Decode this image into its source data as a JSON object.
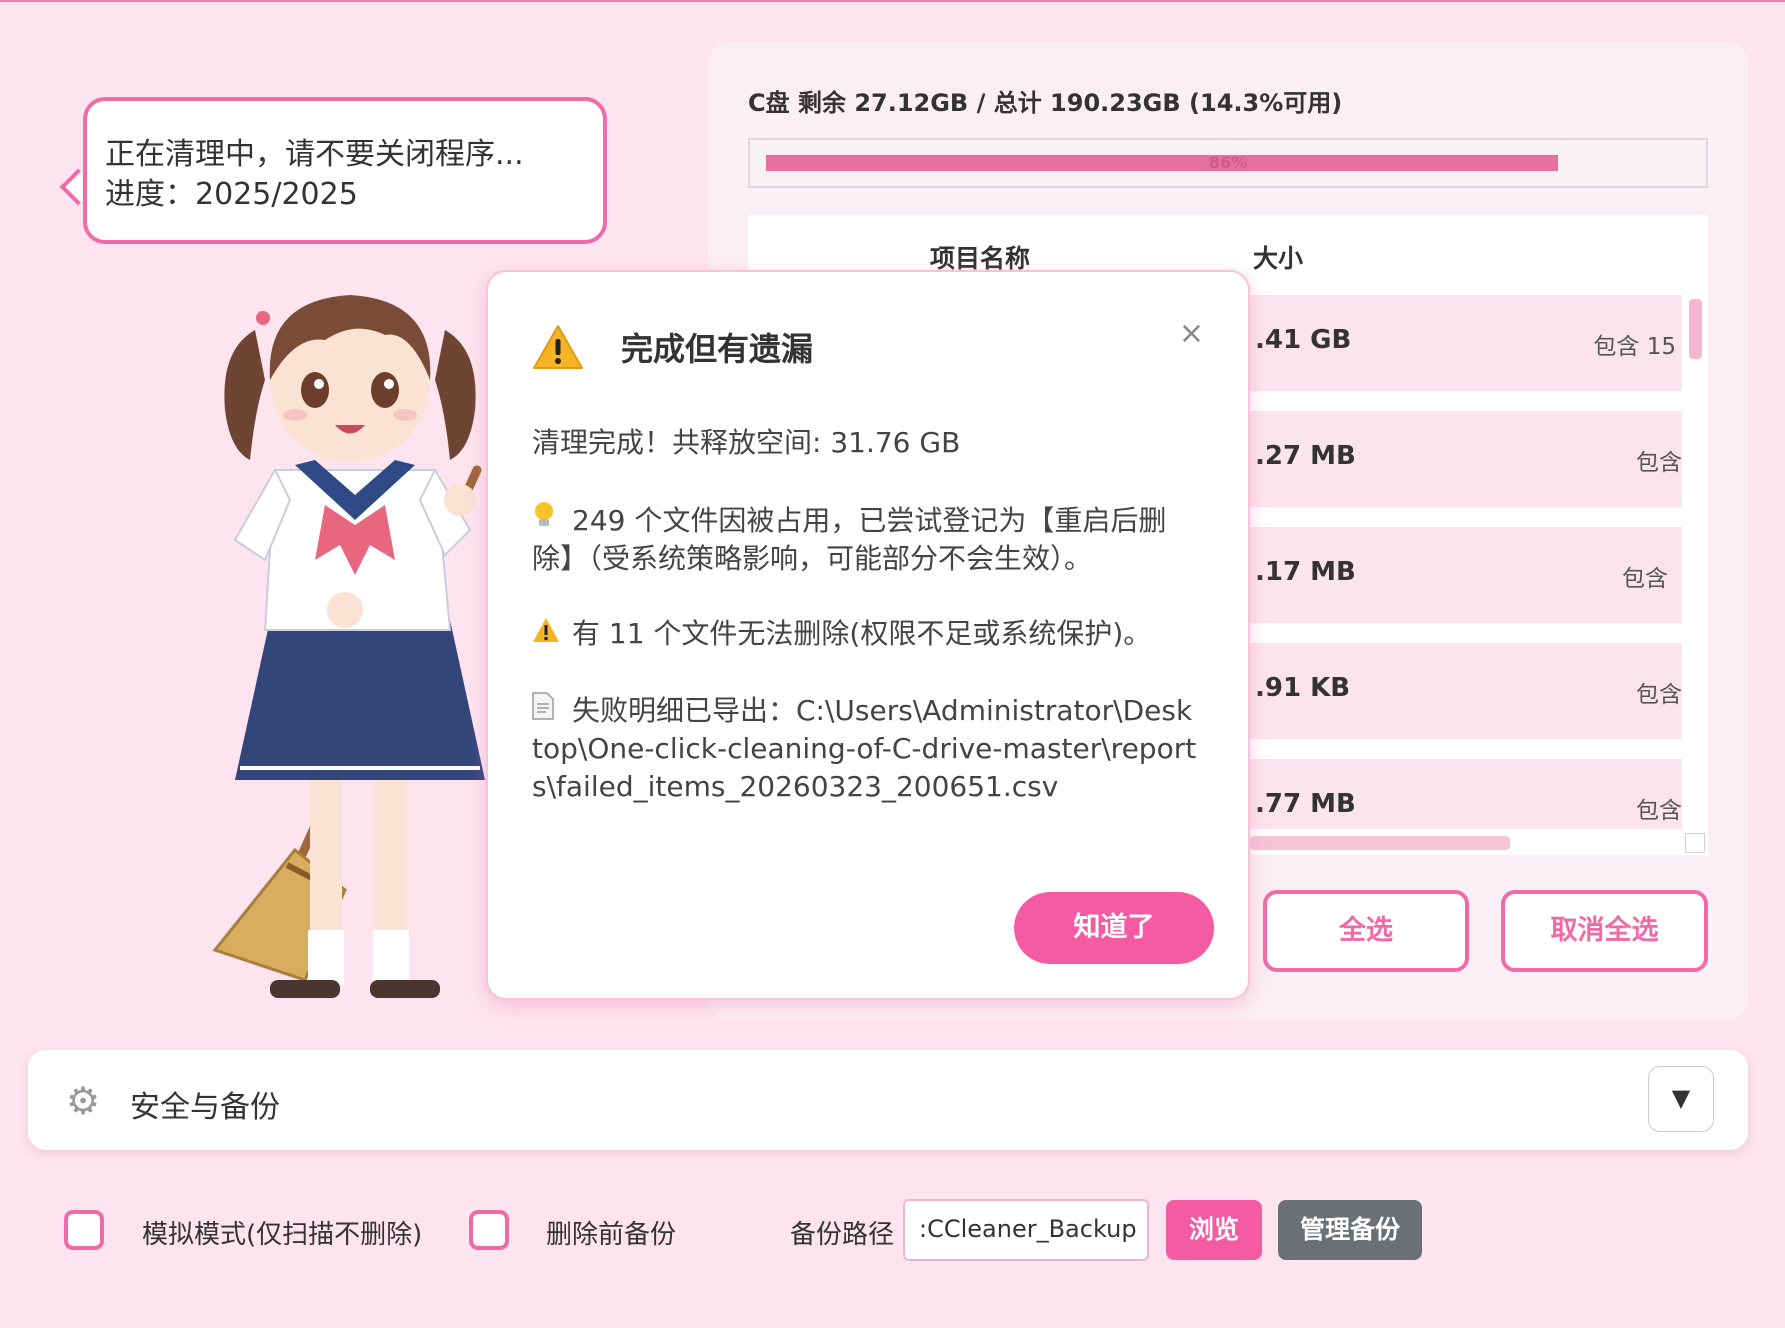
{
  "bubble": {
    "line1": "正在清理中，请不要关闭程序...",
    "line2": "进度：2025/2025"
  },
  "disk": {
    "summary": "C盘 剩余 27.12GB / 总计 190.23GB (14.3%可用)",
    "used_fraction": 0.857,
    "used_label": "86%"
  },
  "table": {
    "headers": {
      "name": "项目名称",
      "size": "大小"
    },
    "rows": [
      {
        "size": ".41 GB",
        "includes": "包含 15"
      },
      {
        "size": ".27 MB",
        "includes": "包含"
      },
      {
        "size": ".17 MB",
        "includes": "包含"
      },
      {
        "size": ".91 KB",
        "includes": "包含"
      },
      {
        "size": ".77 MB",
        "includes": "包含"
      }
    ]
  },
  "buttons": {
    "select_all": "全选",
    "deselect_all": "取消全选"
  },
  "dialog": {
    "title": "完成但有遗漏",
    "close": "×",
    "summary": "清理完成！共释放空间: 31.76 GB",
    "locked_files": "249 个文件因被占用，已尝试登记为【重启后删除】（受系统策略影响，可能部分不会生效）。",
    "failed_files": "有 11 个文件无法删除(权限不足或系统保护)。",
    "export_path": "失败明细已导出：C:\\Users\\Administrator\\Desktop\\One-click-cleaning-of-C-drive-master\\reports\\failed_items_20260323_200651.csv",
    "ok_label": "知道了",
    "icons": [
      "warning-icon",
      "lightbulb-icon",
      "document-icon"
    ]
  },
  "safety": {
    "title": "安全与备份",
    "toggle": "▼"
  },
  "options": {
    "simulate_label": "模拟模式(仅扫描不删除)",
    "simulate_checked": false,
    "backup_label": "删除前备份",
    "backup_checked": false,
    "path_label": "备份路径",
    "path_value": ":CCleaner_Backup",
    "browse_label": "浏览",
    "manage_label": "管理备份"
  },
  "colors": {
    "accent": "#f06aa8",
    "accent_fill": "#f45ba3",
    "background": "#fde4ee",
    "row_bg": "#fce4ee",
    "disk_bar": "#e66f9c",
    "manage_btn": "#6b7075"
  }
}
